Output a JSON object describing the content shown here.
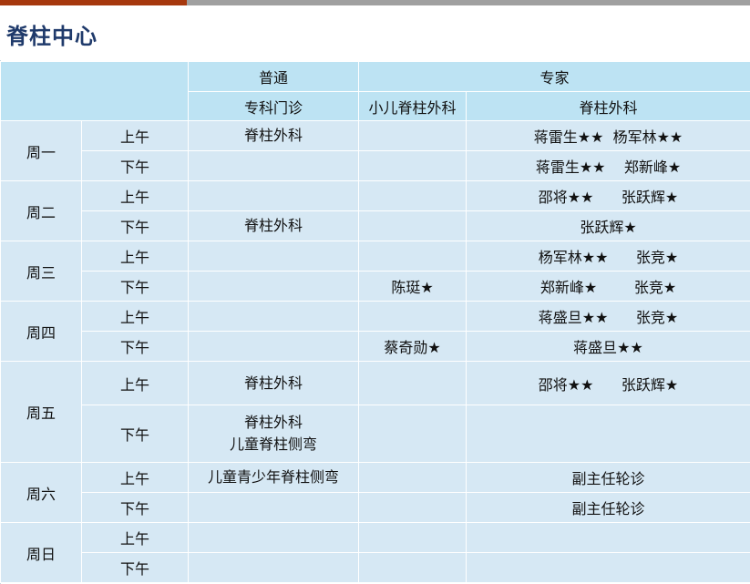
{
  "colors": {
    "accent": "#a6380d",
    "bar_gray": "#a0a0a0",
    "title": "#1f3a6b",
    "header_bg": "#bde3f3",
    "body_bg": "#d6e8f4"
  },
  "title": "脊柱中心",
  "header": {
    "group_general": "普通",
    "group_expert": "专家",
    "col_general": "专科门诊",
    "col_peds": "小儿脊柱外科",
    "col_spine": "脊柱外科"
  },
  "days": [
    {
      "day": "周一",
      "sessions": [
        {
          "period": "上午",
          "general": [
            "脊柱外科"
          ],
          "peds": "",
          "spine": "蒋雷生★★  杨军林★★"
        },
        {
          "period": "下午",
          "general": [],
          "peds": "",
          "spine": "蒋雷生★★    郑新峰★"
        }
      ]
    },
    {
      "day": "周二",
      "sessions": [
        {
          "period": "上午",
          "general": [],
          "peds": "",
          "spine": "邵将★★      张跃辉★"
        },
        {
          "period": "下午",
          "general": [
            "脊柱外科"
          ],
          "peds": "",
          "spine": "张跃辉★"
        }
      ]
    },
    {
      "day": "周三",
      "sessions": [
        {
          "period": "上午",
          "general": [],
          "peds": "",
          "spine": "杨军林★★      张竞★"
        },
        {
          "period": "下午",
          "general": [],
          "peds": "陈珽★",
          "spine": "郑新峰★        张竞★"
        }
      ]
    },
    {
      "day": "周四",
      "sessions": [
        {
          "period": "上午",
          "general": [],
          "peds": "",
          "spine": "蒋盛旦★★      张竞★"
        },
        {
          "period": "下午",
          "general": [],
          "peds": "蔡奇勋★",
          "spine": "蒋盛旦★★"
        }
      ]
    },
    {
      "day": "周五",
      "sessions": [
        {
          "period": "上午",
          "general": [
            "脊柱外科"
          ],
          "peds": "",
          "spine": "邵将★★      张跃辉★"
        },
        {
          "period": "下午",
          "general": [
            "脊柱外科",
            "儿童脊柱侧弯"
          ],
          "peds": "",
          "spine": ""
        }
      ]
    },
    {
      "day": "周六",
      "sessions": [
        {
          "period": "上午",
          "general": [
            "儿童青少年脊柱侧弯"
          ],
          "peds": "",
          "spine": "副主任轮诊"
        },
        {
          "period": "下午",
          "general": [],
          "peds": "",
          "spine": "副主任轮诊"
        }
      ]
    },
    {
      "day": "周日",
      "sessions": [
        {
          "period": "上午",
          "general": [],
          "peds": "",
          "spine": ""
        },
        {
          "period": "下午",
          "general": [],
          "peds": "",
          "spine": ""
        }
      ]
    }
  ]
}
